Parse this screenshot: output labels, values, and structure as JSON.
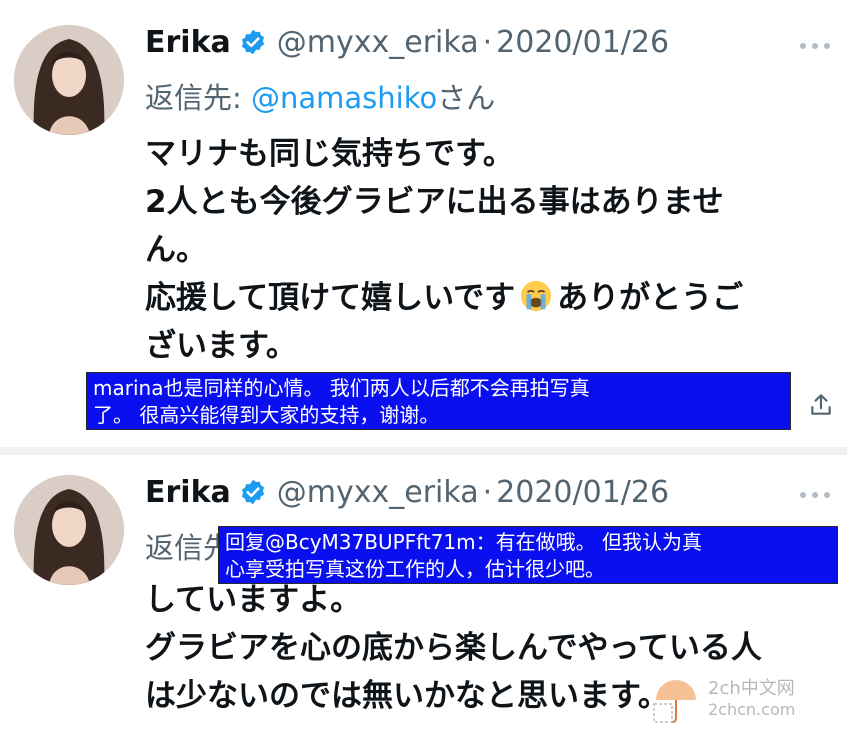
{
  "tweets": [
    {
      "name": "Erika",
      "handle": "@myxx_erika",
      "separator": "·",
      "date": "2020/01/26",
      "reply_prefix": "返信先: ",
      "reply_to": "@namashiko",
      "reply_suffix": "さん",
      "lines": [
        "マリナも同じ気持ちです。",
        "2人とも今後グラビアに出る事はありませ",
        "ん。",
        "応援して頂けて嬉しいです",
        "ありがとうご",
        "ざいます。"
      ],
      "emoji": "loudly-crying-face",
      "translation": [
        "marina也是同样的心情。 我们两人以后都不会再拍写真",
        "了。 很高兴能得到大家的支持，谢谢。"
      ]
    },
    {
      "name": "Erika",
      "handle": "@myxx_erika",
      "separator": "·",
      "date": "2020/01/26",
      "reply_prefix": "返信先",
      "lines": [
        "していますよ。",
        "グラビアを心の底から楽しんでやっている人",
        "は少ないのでは無いかなと思います。"
      ],
      "translation": [
        "回复@BcyM37BUPFft71m：有在做哦。 但我认为真",
        "心享受拍写真这份工作的人，估计很少吧。"
      ]
    }
  ],
  "watermark": {
    "line1": "2ch中文网",
    "line2": "2chcn.com"
  },
  "colors": {
    "link": "#1d9bf0",
    "verified": "#1d9bf0",
    "overlay_bg": "#0a0ff0",
    "secondary_text": "#536471"
  },
  "icons": [
    "verified-badge-icon",
    "more-icon",
    "share-icon",
    "crying-emoji-icon",
    "watermark-logo-icon"
  ]
}
